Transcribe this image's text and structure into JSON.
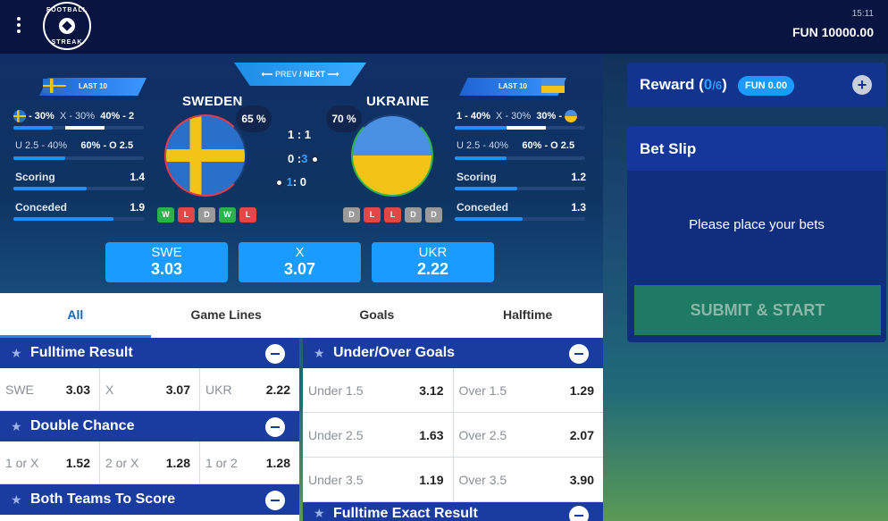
{
  "header": {
    "time": "15:11",
    "balance": "FUN 10000.00",
    "logo_top": "FOOTBALL",
    "logo_bottom": "STREAK"
  },
  "match": {
    "nav": {
      "prev": "PREV",
      "sep": "/",
      "next": "NEXT"
    },
    "home": {
      "name": "SWEDEN",
      "last_label": "LAST 10",
      "l1": "- 30%",
      "l1b": "X - 30%",
      "l1c": "40% - 2",
      "under": "U 2.5 - 40%",
      "over": "60% - O 2.5",
      "scoring_label": "Scoring",
      "scoring": "1.4",
      "conceded_label": "Conceded",
      "conceded": "1.9",
      "pct": "65 %",
      "form": [
        "W",
        "L",
        "D",
        "W",
        "L"
      ]
    },
    "away": {
      "name": "UKRAINE",
      "last_label": "LAST 10",
      "l1": "1 - 40%",
      "l1b": "X - 30%",
      "l1c": "30% -",
      "under": "U 2.5 - 40%",
      "over": "60% - O 2.5",
      "scoring_label": "Scoring",
      "scoring": "1.2",
      "conceded_label": "Conceded",
      "conceded": "1.3",
      "pct": "70 %",
      "form": [
        "D",
        "L",
        "L",
        "D",
        "D"
      ]
    },
    "scores": {
      "s1": "1 : 1",
      "s2a": "0 :",
      "s2b": "3",
      "s3a": "1",
      "s3b": ": 0"
    },
    "odds": [
      {
        "label": "SWE",
        "value": "3.03"
      },
      {
        "label": "X",
        "value": "3.07"
      },
      {
        "label": "UKR",
        "value": "2.22"
      }
    ]
  },
  "tabs": [
    "All",
    "Game Lines",
    "Goals",
    "Halftime"
  ],
  "markets": {
    "fulltime": {
      "title": "Fulltime Result",
      "cells": [
        [
          "SWE",
          "3.03"
        ],
        [
          "X",
          "3.07"
        ],
        [
          "UKR",
          "2.22"
        ]
      ]
    },
    "double": {
      "title": "Double Chance",
      "cells": [
        [
          "1 or X",
          "1.52"
        ],
        [
          "2 or X",
          "1.28"
        ],
        [
          "1 or 2",
          "1.28"
        ]
      ]
    },
    "btts": {
      "title": "Both Teams To Score"
    },
    "underover": {
      "title": "Under/Over Goals",
      "rows": [
        [
          [
            "Under 1.5",
            "3.12"
          ],
          [
            "Over 1.5",
            "1.29"
          ]
        ],
        [
          [
            "Under 2.5",
            "1.63"
          ],
          [
            "Over 2.5",
            "2.07"
          ]
        ],
        [
          [
            "Under 3.5",
            "1.19"
          ],
          [
            "Over 3.5",
            "3.90"
          ]
        ]
      ]
    },
    "exact": {
      "title": "Fulltime Exact Result"
    }
  },
  "sidebar": {
    "reward_label": "Reward (",
    "reward_count": "0",
    "reward_total": "/6",
    "reward_close": ")",
    "fun_chip": "FUN 0.00",
    "betslip_title": "Bet Slip",
    "empty_msg": "Please place your bets",
    "submit": "SUBMIT & START"
  },
  "colors": {
    "accent": "#1a9bff",
    "header": "#0a1440",
    "market_head": "#1a3ca0",
    "win": "#2bb24a",
    "loss": "#e24646",
    "draw": "#9a9a9a"
  }
}
